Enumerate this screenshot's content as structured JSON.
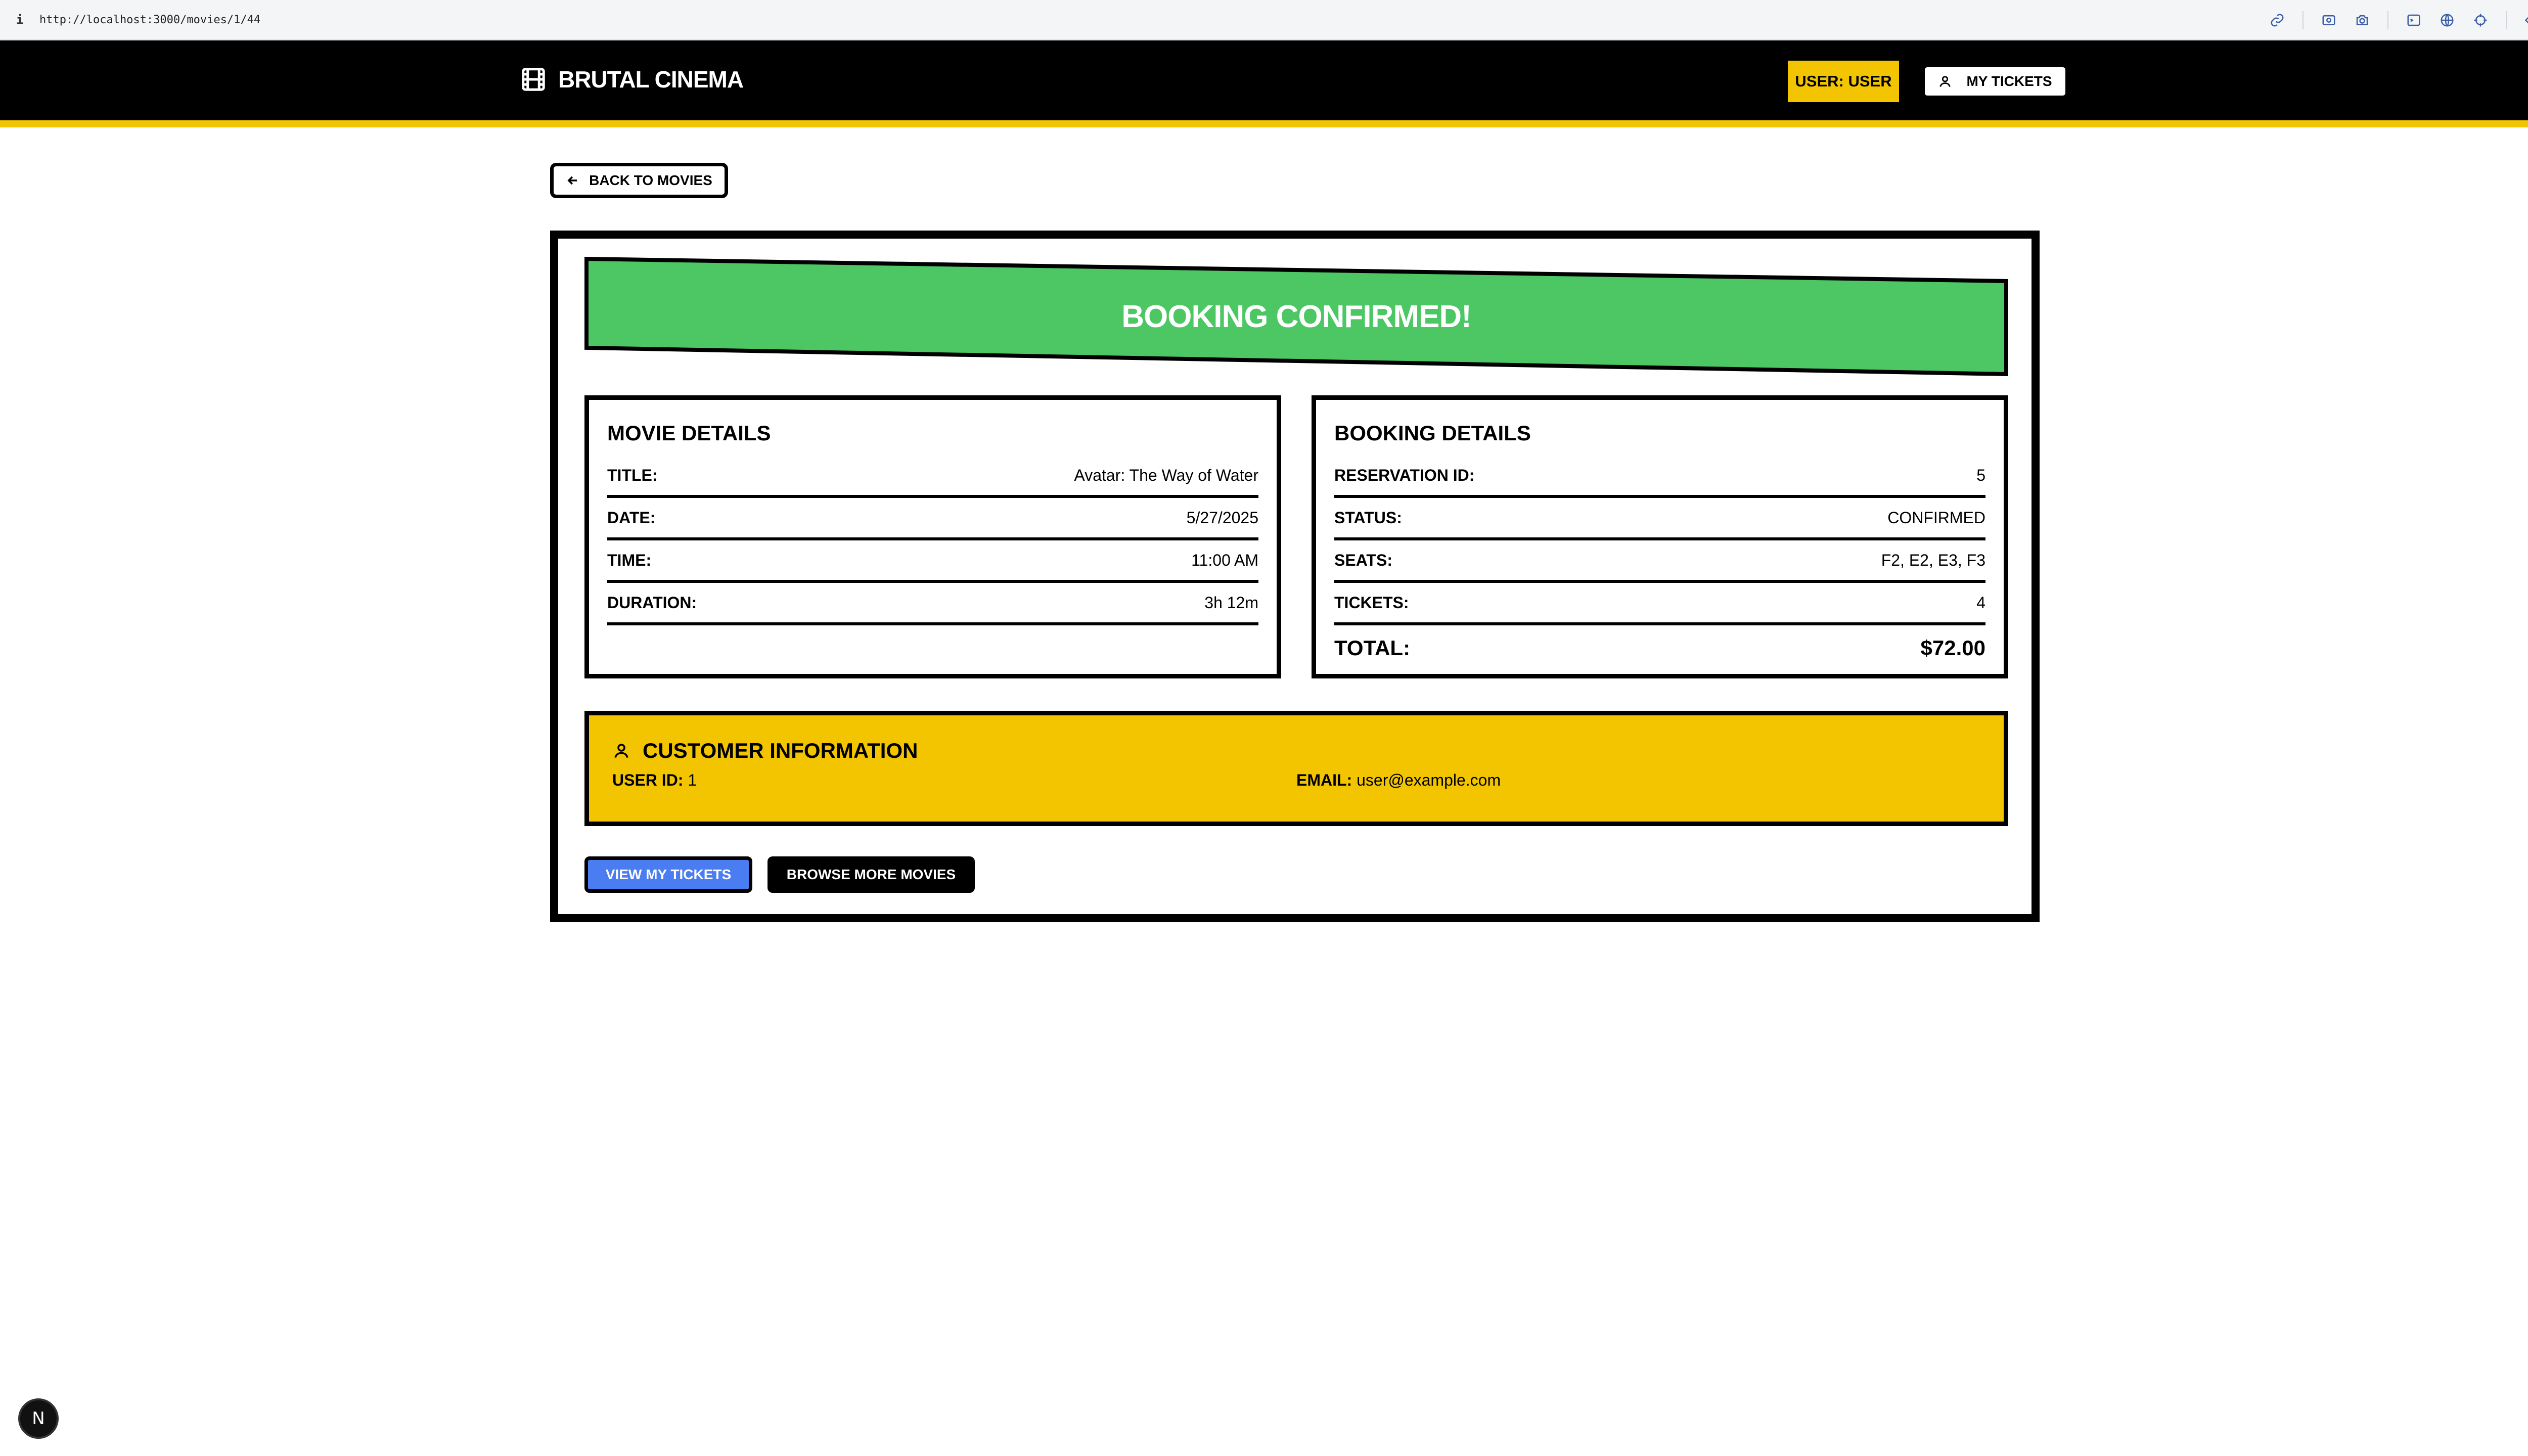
{
  "browser": {
    "info_glyph": "i",
    "url": "http://localhost:3000/movies/1/44",
    "icons": [
      "link-icon",
      "screenshot-icon",
      "camera-icon",
      "terminal-icon",
      "globe-icon",
      "target-icon",
      "code-icon",
      "sidebar-icon"
    ]
  },
  "header": {
    "brand": "BRUTAL CINEMA",
    "user_badge": "USER: USER",
    "my_tickets": "MY TICKETS"
  },
  "back_button": "BACK TO MOVIES",
  "banner": {
    "text": "BOOKING CONFIRMED!"
  },
  "movie_details": {
    "title": "MOVIE DETAILS",
    "rows": [
      {
        "label": "TITLE:",
        "value": "Avatar: The Way of Water"
      },
      {
        "label": "DATE:",
        "value": "5/27/2025"
      },
      {
        "label": "TIME:",
        "value": "11:00 AM"
      },
      {
        "label": "DURATION:",
        "value": "3h 12m"
      }
    ]
  },
  "booking_details": {
    "title": "BOOKING DETAILS",
    "rows": [
      {
        "label": "RESERVATION ID:",
        "value": "5"
      },
      {
        "label": "STATUS:",
        "value": "CONFIRMED"
      },
      {
        "label": "SEATS:",
        "value": "F2, E2, E3, F3"
      },
      {
        "label": "TICKETS:",
        "value": "4"
      }
    ],
    "total_label": "TOTAL:",
    "total_value": "$72.00"
  },
  "customer": {
    "title": "CUSTOMER INFORMATION",
    "user_id_label": "USER ID:",
    "user_id": "1",
    "email_label": "EMAIL:",
    "email": "user@example.com"
  },
  "actions": {
    "view_tickets": "VIEW MY TICKETS",
    "browse_movies": "BROWSE MORE MOVIES"
  },
  "dev_badge": "N",
  "colors": {
    "accent_yellow": "#f2c500",
    "banner_green": "#4cc764",
    "button_blue": "#4a7cf2",
    "header_black": "#000000"
  }
}
